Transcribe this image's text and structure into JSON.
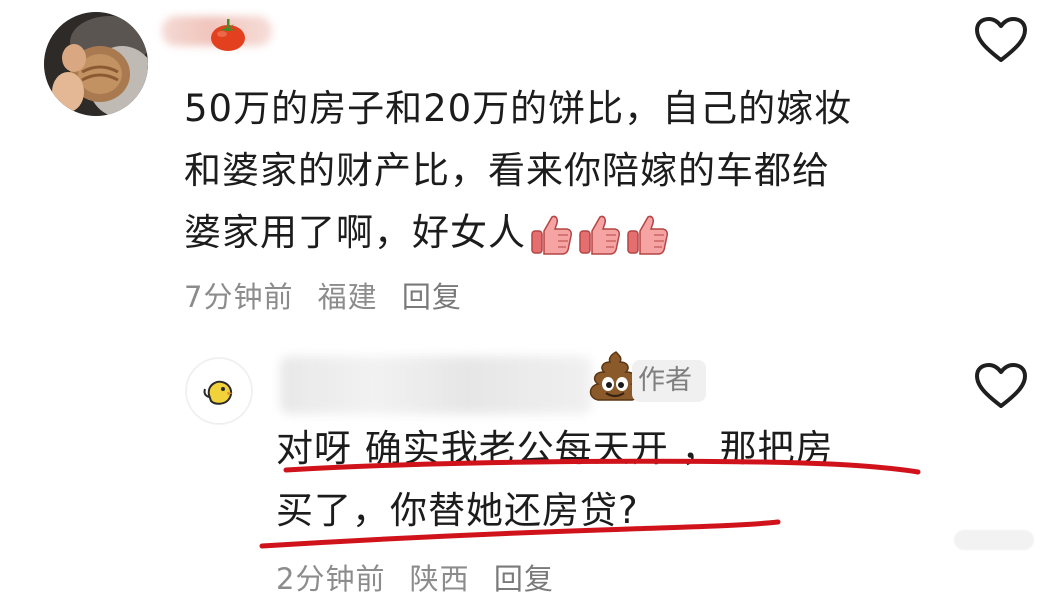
{
  "comment": {
    "text_lines": [
      "50万的房子和20万的饼比，自己的嫁妆",
      "和婆家的财产比，看来你陪嫁的车都给",
      "婆家用了啊，好女人"
    ],
    "emoji_icons": [
      "thumbs-up-icon",
      "thumbs-up-icon",
      "thumbs-up-icon"
    ],
    "time": "7分钟前",
    "location": "福建",
    "reply_label": "回复"
  },
  "reply": {
    "author_badge": "作者",
    "text_lines": [
      "对呀 确实我老公每天开 ，那把房",
      "买了，你替她还房贷?"
    ],
    "time": "2分钟前",
    "location": "陕西",
    "reply_label": "回复"
  },
  "colors": {
    "meta_gray": "#8c8c8c",
    "underline_red": "#d0121b",
    "thumb_pink": "#f08a8a",
    "heart_stroke": "#1f1f1f"
  }
}
